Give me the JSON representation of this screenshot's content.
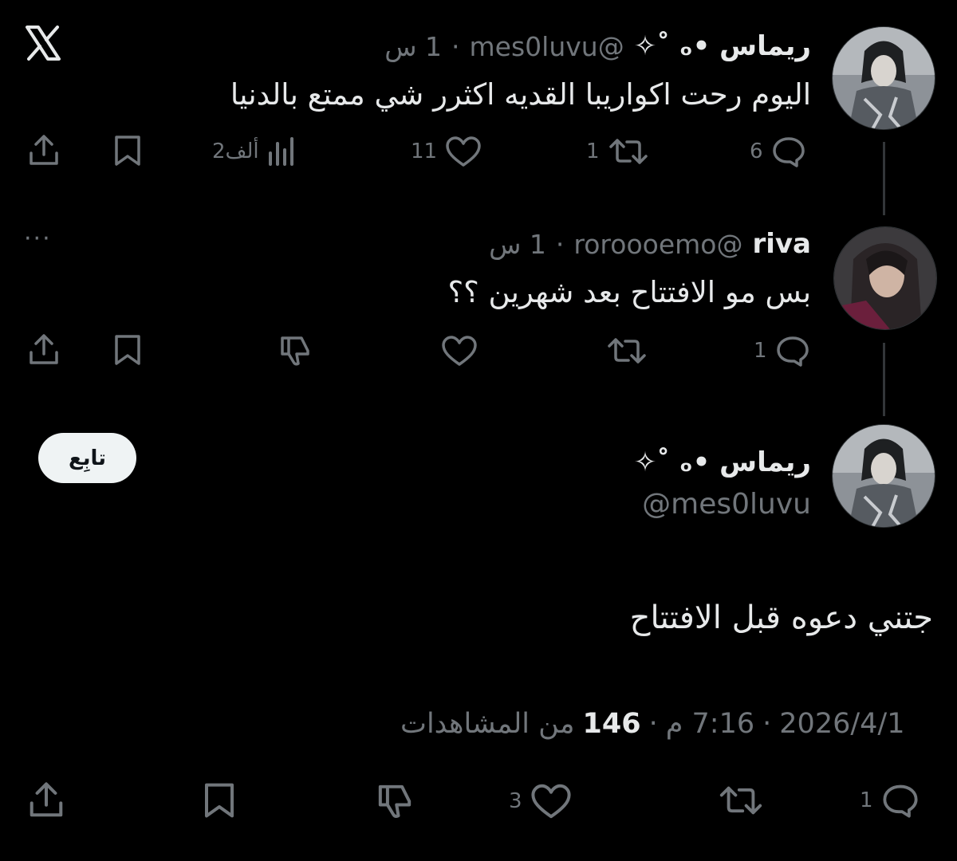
{
  "app": {
    "logo": "x-logo-icon"
  },
  "tweets": [
    {
      "name": "ريماس •ₒ ˚✧",
      "handle": "@mes0luvu",
      "time": "1 س",
      "text": "اليوم رحت اكواريبا القديه اكثرر شي ممتع بالدنيا",
      "replies": "6",
      "retweets": "1",
      "likes": "11",
      "views": "2ألف"
    },
    {
      "name": "riva",
      "handle": "@roroooemo",
      "time": "1 س",
      "text": "بس مو الافتتاح بعد شهرين ؟؟",
      "replies": "1",
      "more": "···"
    }
  ],
  "focused": {
    "name": "ريماس •ₒ ˚✧",
    "handle": "@mes0luvu",
    "follow_label": "تابِع",
    "text": "جتني دعوه قبل الافتتاح",
    "date": "2026/4/1",
    "time": "7:16 م",
    "views_count": "146",
    "views_label": "من المشاهدات",
    "sep": "·",
    "replies": "1",
    "likes": "3"
  },
  "colors": {
    "background": "#000000",
    "text": "#e7e9ea",
    "muted": "#71767b",
    "line": "#333639"
  }
}
